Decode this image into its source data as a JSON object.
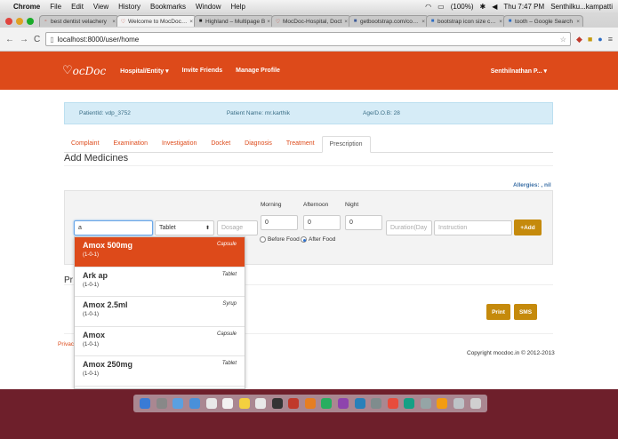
{
  "menubar": {
    "apple": "",
    "app": "Chrome",
    "items": [
      "File",
      "Edit",
      "View",
      "History",
      "Bookmarks",
      "Window",
      "Help"
    ],
    "battery": "(100%)",
    "clock": "Thu 7:47 PM",
    "user": "Senthilku...kampatti"
  },
  "browser": {
    "tabs": [
      {
        "title": "best dentist velachery",
        "close": "×"
      },
      {
        "title": "Welcome to MocDoc - A",
        "close": "×"
      },
      {
        "title": "Highland – Multipage B",
        "close": "×"
      },
      {
        "title": "MocDoc-Hospital, Doct",
        "close": "×"
      },
      {
        "title": "getbootstrap.com/comp",
        "close": "×"
      },
      {
        "title": "bootstrap icon size char",
        "close": "×"
      },
      {
        "title": "tooth – Google Search",
        "close": "×"
      }
    ],
    "url": "localhost:8000/user/home",
    "back": "←",
    "forward": "→",
    "reload": "C"
  },
  "site": {
    "logo": "ocDoc",
    "logo_heart": "♡",
    "nav": [
      "Hospital/Entity ▾",
      "Invite Friends",
      "Manage Profile"
    ],
    "user": "Senthilnathan P... ▾"
  },
  "patient": {
    "id": "PatientId: vdp_3752",
    "name": "Patient Name: mr.karthik",
    "age": "Age/D.O.B: 28"
  },
  "page_tabs": [
    "Complaint",
    "Examination",
    "Investigation",
    "Docket",
    "Diagnosis",
    "Treatment",
    "Prescription"
  ],
  "add_medicines": {
    "heading": "Add Medicines",
    "allergies": "Allergies: , nil",
    "search_value": "a",
    "form_select": "Tablet",
    "dosage_placeholder": "Dosage",
    "morning_label": "Morning",
    "afternoon_label": "Afternoon",
    "night_label": "Night",
    "morning_value": "0",
    "afternoon_value": "0",
    "night_value": "0",
    "before_food": "Before Food",
    "after_food": "After Food",
    "duration_placeholder": "Duration(Day",
    "instruction_placeholder": "Instruction",
    "add_button": "+Add"
  },
  "autocomplete": [
    {
      "name": "Amox 500mg",
      "form": "Capsule",
      "dose": "(1-0-1)"
    },
    {
      "name": "Ark ap",
      "form": "Tablet",
      "dose": "(1-0-1)"
    },
    {
      "name": "Amox 2.5ml",
      "form": "Syrup",
      "dose": "(1-0-1)"
    },
    {
      "name": "Amox",
      "form": "Capsule",
      "dose": "(1-0-1)"
    },
    {
      "name": "Amox 250mg",
      "form": "Tablet",
      "dose": "(1-0-1)"
    }
  ],
  "prescription_heading": "Pr",
  "print_button": "Print",
  "sms_button": "SMS",
  "privacy": "Privac",
  "copyright": "Copyright mocdoc.in © 2012-2013",
  "colors": {
    "brand": "#dd4a1a",
    "gold": "#c58a0c",
    "info": "#d6ecf7"
  }
}
